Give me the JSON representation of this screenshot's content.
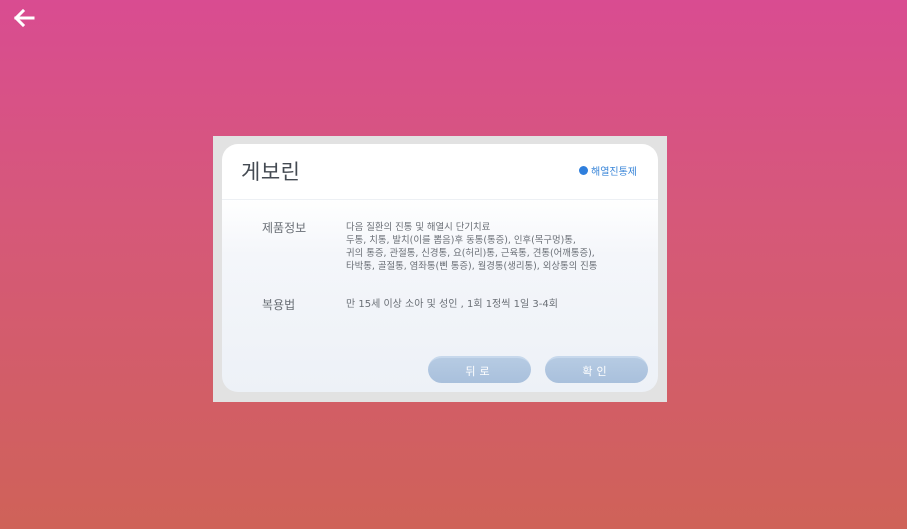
{
  "nav": {
    "back_icon": "arrow-left-icon"
  },
  "dialog": {
    "title": "게보린",
    "category": "해열진통제",
    "category_color": "#2f7fdd",
    "product_info_label": "제품정보",
    "product_info_lines": [
      "다음 질환의 진통 및 해열시 단기치료",
      "두통, 치통, 발치(이를 뽑음)후 동통(통증), 인후(목구멍)통,",
      "귀의 통증, 관절통, 신경통, 요(허리)통, 근육통, 견통(어깨통증),",
      "타박통, 골절통, 염좌통(삔 통증), 월경통(생리통), 외상통의 진통"
    ],
    "dosage_label": "복용법",
    "dosage_text": "만 15세 이상 소아 및 성인 , 1회 1정씩 1일 3-4회",
    "back_button_label": "뒤로",
    "ok_button_label": "확인"
  },
  "colors": {
    "background_top": "#d94c91",
    "background_bottom": "#cf6258",
    "button_fill": "#afc6df"
  }
}
